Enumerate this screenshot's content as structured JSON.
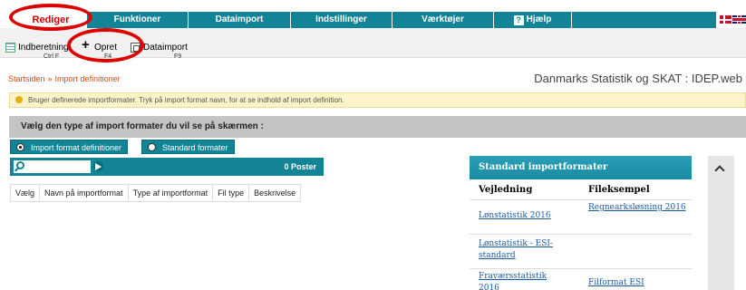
{
  "menu": {
    "active": "Rediger",
    "items": [
      "Funktioner",
      "Dataimport",
      "Indstillinger",
      "Værktøjer",
      "Hjælp"
    ]
  },
  "toolbar": {
    "indberetning_label": "Indberetning",
    "indberetning_shortcut": "Ctrl F",
    "opret_label": "Opret",
    "opret_shortcut": "F4",
    "dataimport_label": "Dataimport",
    "dataimport_shortcut": "F9"
  },
  "breadcrumb": {
    "home": "Startsiden",
    "separator": "»",
    "current": "Import definitioner"
  },
  "site_title": "Danmarks Statistik og SKAT : IDEP.web",
  "info_message": "Bruger definerede importformater. Tryk på import format navn, for at se indhold af import definition.",
  "choice": {
    "heading": "Vælg den type af import formater du vil se på skærmen :",
    "options": [
      "Import format definitioner",
      "Standard formater"
    ],
    "selected": "Import format definitioner"
  },
  "search": {
    "value": "",
    "count_label": "0 Poster"
  },
  "table_columns": [
    "Vælg",
    "Navn på importformat",
    "Type af importformat",
    "Fil type",
    "Beskrivelse"
  ],
  "standard_panel": {
    "title": "Standard importformater",
    "col_vejledning": "Vejledning",
    "col_fileksempel": "Fileksempel",
    "rows": [
      {
        "vejledning": "Lønstatistik 2016",
        "fileksempel": "Regnearksløsning 2016"
      },
      {
        "vejledning": "Lønstatistik - ESI-standard",
        "fileksempel": ""
      },
      {
        "vejledning": "Fraværsstatistik 2016",
        "fileksempel": "Filformat ESI"
      }
    ]
  },
  "colors": {
    "menu_teal": "#128495",
    "active_red": "#cc0000",
    "annotation_red": "#dd0000",
    "breadcrumb_orange": "#c8501e",
    "info_bg": "#fdf3c8",
    "link_blue": "#1a5aa0"
  }
}
